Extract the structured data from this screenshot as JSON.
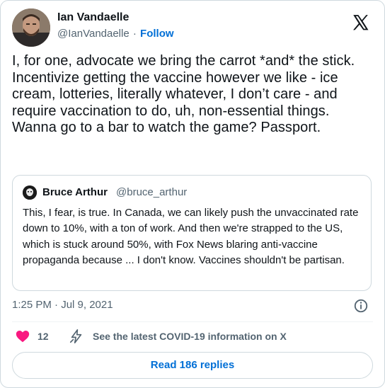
{
  "author": {
    "name": "Ian Vandaelle",
    "handle": "@IanVandaelle",
    "separator": "·",
    "follow_label": "Follow"
  },
  "tweet": {
    "text": "I, for one, advocate we bring the carrot *and* the stick. Incentivize getting the vaccine however we like - ice cream, lotteries, literally whatever, I don’t care - and require vaccination to do, uh, non-essential things. Wanna go to a bar to watch the game? Passport."
  },
  "quoted_tweet": {
    "name": "Bruce Arthur",
    "handle": "@bruce_arthur",
    "text": "This, I fear, is true. In Canada, we can likely push the unvaccinated rate down to 10%, with a ton of work. And then we're strapped to the US, which is stuck around 50%, with Fox News blaring anti-vaccine propaganda because ... I don't know. Vaccines shouldn't be partisan."
  },
  "meta": {
    "timestamp": "1:25 PM · Jul 9, 2021"
  },
  "actions": {
    "like_count": "12",
    "covid_info_label": "See the latest COVID-19 information on X"
  },
  "replies": {
    "read_label": "Read 186 replies"
  },
  "icons": {
    "logo": "x-logo-icon",
    "info": "info-icon",
    "like": "heart-icon",
    "covid": "lightning-bolt-icon"
  },
  "colors": {
    "accent": "#006fd6",
    "like": "#f91880",
    "muted": "#536471",
    "border": "#cfd9de"
  }
}
